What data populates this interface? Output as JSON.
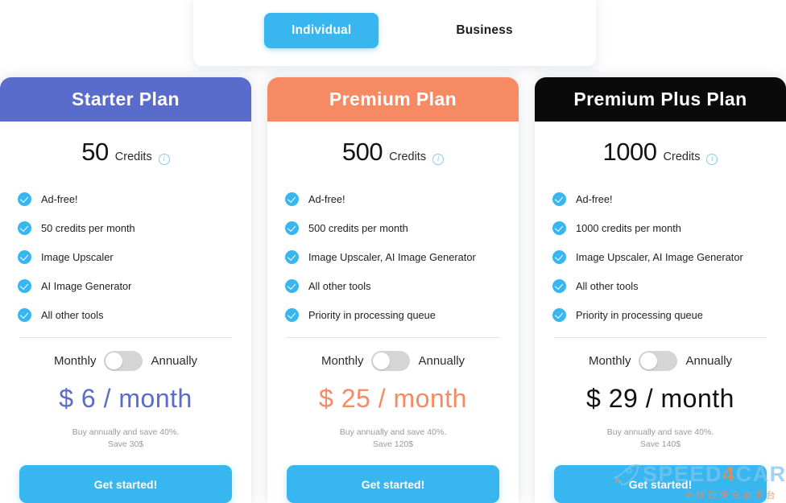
{
  "tabs": [
    {
      "label": "Individual",
      "active": true
    },
    {
      "label": "Business",
      "active": false
    }
  ],
  "colors": {
    "accent_blue": "#38b6f0",
    "starter": "#5a6ccb",
    "premium": "#f58a63",
    "premium_plus": "#0a0a0a",
    "watermark_blue": "#7fc4ee",
    "watermark_orange": "#f58a4b"
  },
  "info_icon_glyph": "i",
  "plans": [
    {
      "title": "Starter Plan",
      "header_color": "#5a6ccb",
      "credits_number": "50",
      "credits_label": "Credits",
      "features": [
        "Ad-free!",
        "50 credits per month",
        "Image Upscaler",
        "AI Image Generator",
        "All other tools"
      ],
      "toggle": {
        "left_label": "Monthly",
        "right_label": "Annually",
        "on": false
      },
      "price": "$ 6 / month",
      "price_color": "#5a6ccb",
      "note_line1": "Buy annually and save 40%.",
      "note_line2": "Save 30$",
      "cta_label": "Get started!"
    },
    {
      "title": "Premium Plan",
      "header_color": "#f58a63",
      "credits_number": "500",
      "credits_label": "Credits",
      "features": [
        "Ad-free!",
        "500 credits per month",
        "Image Upscaler, AI Image Generator",
        "All other tools",
        "Priority in processing queue"
      ],
      "toggle": {
        "left_label": "Monthly",
        "right_label": "Annually",
        "on": false
      },
      "price": "$ 25 / month",
      "price_color": "#f58a63",
      "note_line1": "Buy annually and save 40%.",
      "note_line2": "Save 120$",
      "cta_label": "Get started!"
    },
    {
      "title": "Premium Plus Plan",
      "header_color": "#0a0a0a",
      "credits_number": "1000",
      "credits_label": "Credits",
      "features": [
        "Ad-free!",
        "1000 credits per month",
        "Image Upscaler, AI Image Generator",
        "All other tools",
        "Priority in processing queue"
      ],
      "toggle": {
        "left_label": "Monthly",
        "right_label": "Annually",
        "on": false
      },
      "price": "$ 29 / month",
      "price_color": "#111111",
      "note_line1": "Buy annually and save 40%.",
      "note_line2": "Save 140$",
      "cta_label": "Get started!"
    }
  ],
  "watermark": {
    "brand_prefix": "SPEED",
    "brand_four": "4",
    "brand_suffix": "CARD",
    "subtitle": "全球跨境充值平台"
  }
}
